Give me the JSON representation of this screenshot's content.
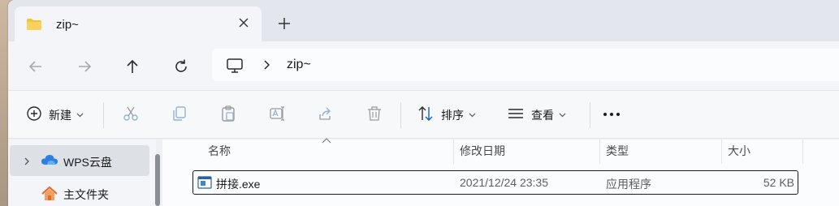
{
  "tabs": [
    {
      "title": "zip~",
      "active": true
    }
  ],
  "address_bar": {
    "path": "zip~"
  },
  "command_bar": {
    "new_label": "新建",
    "sort_label": "排序",
    "view_label": "查看",
    "more_label": "···"
  },
  "nav_pane": {
    "items": [
      {
        "label": "WPS云盘",
        "selected": true,
        "icon": "wps-cloud-icon"
      },
      {
        "label": "主文件夹",
        "selected": false,
        "icon": "home-icon"
      }
    ]
  },
  "file_list": {
    "columns": [
      "名称",
      "修改日期",
      "类型",
      "大小"
    ],
    "rows": [
      {
        "name": "拼接.exe",
        "modified": "2021/12/24 23:35",
        "type": "应用程序",
        "size": "52 KB"
      }
    ]
  },
  "colors": {
    "window_bg": "#eef0f4",
    "cloud_blue": "#2f7fe0",
    "home_orange": "#e46a2f",
    "folder_yellow": "#f3c13b"
  }
}
